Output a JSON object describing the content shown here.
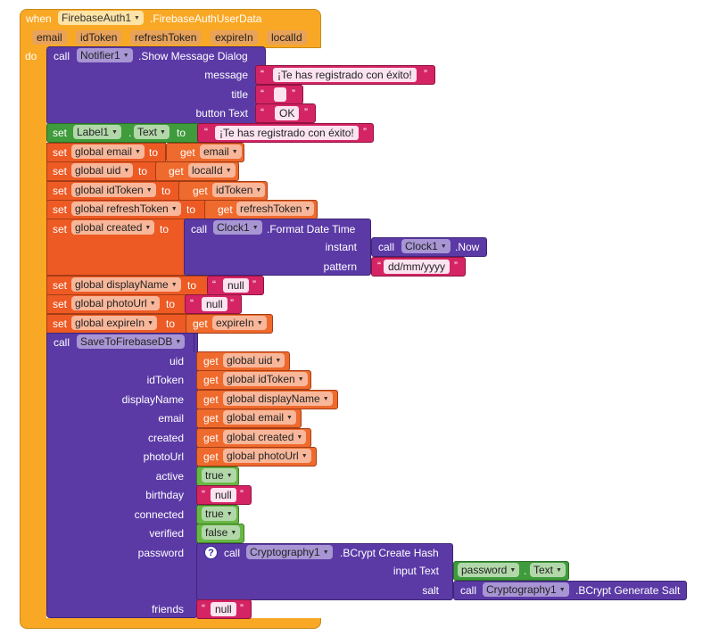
{
  "event": {
    "when": "when",
    "component": "FirebaseAuth1",
    "event_name": ".FirebaseAuthUserData",
    "params": [
      "email",
      "idToken",
      "refreshToken",
      "expireIn",
      "localId"
    ],
    "do": "do"
  },
  "notifier": {
    "call": "call",
    "component": "Notifier1",
    "method": ".Show Message Dialog",
    "message_label": "message",
    "message": "¡Te has registrado con éxito!",
    "title_label": "title",
    "title": "",
    "button_label": "button Text",
    "button": "OK"
  },
  "set_label": {
    "set": "set",
    "component": "Label1",
    "dot": ".",
    "prop": "Text",
    "to": "to",
    "value": "¡Te has registrado con éxito!"
  },
  "sets": [
    {
      "set": "set",
      "var": "global email",
      "to": "to",
      "get": "get",
      "value": "email"
    },
    {
      "set": "set",
      "var": "global uid",
      "to": "to",
      "get": "get",
      "value": "localId"
    },
    {
      "set": "set",
      "var": "global idToken",
      "to": "to",
      "get": "get",
      "value": "idToken"
    },
    {
      "set": "set",
      "var": "global refreshToken",
      "to": "to",
      "get": "get",
      "value": "refreshToken"
    }
  ],
  "created": {
    "set": "set",
    "var": "global created",
    "to": "to",
    "call": "call",
    "component": "Clock1",
    "method": ".Format Date Time",
    "instant_label": "instant",
    "now_call": "call",
    "now_component": "Clock1",
    "now_method": ".Now",
    "pattern_label": "pattern",
    "pattern": "dd/mm/yyyy"
  },
  "sets2": [
    {
      "set": "set",
      "var": "global displayName",
      "to": "to",
      "value": "null"
    },
    {
      "set": "set",
      "var": "global photoUrl",
      "to": "to",
      "value": "null"
    },
    {
      "set": "set",
      "var": "global expireIn",
      "to": "to",
      "get": "get",
      "getvalue": "expireIn"
    }
  ],
  "save": {
    "call": "call",
    "proc": "SaveToFirebaseDB",
    "args": [
      {
        "label": "uid",
        "get": "get",
        "value": "global uid"
      },
      {
        "label": "idToken",
        "get": "get",
        "value": "global idToken"
      },
      {
        "label": "displayName",
        "get": "get",
        "value": "global displayName"
      },
      {
        "label": "email",
        "get": "get",
        "value": "global email"
      },
      {
        "label": "created",
        "get": "get",
        "value": "global created"
      },
      {
        "label": "photoUrl",
        "get": "get",
        "value": "global photoUrl"
      }
    ],
    "active_label": "active",
    "active": "true",
    "birthday_label": "birthday",
    "birthday": "null",
    "connected_label": "connected",
    "connected": "true",
    "verified_label": "verified",
    "verified": "false",
    "password_label": "password",
    "crypto_help": "?",
    "crypto_call": "call",
    "crypto_component": "Cryptography1",
    "crypto_method": ".BCrypt Create Hash",
    "input_label": "input Text",
    "pw_component": "password",
    "pw_dot": ".",
    "pw_prop": "Text",
    "salt_label": "salt",
    "salt_call": "call",
    "salt_component": "Cryptography1",
    "salt_method": ".BCrypt Generate Salt",
    "friends_label": "friends",
    "friends": "null"
  }
}
